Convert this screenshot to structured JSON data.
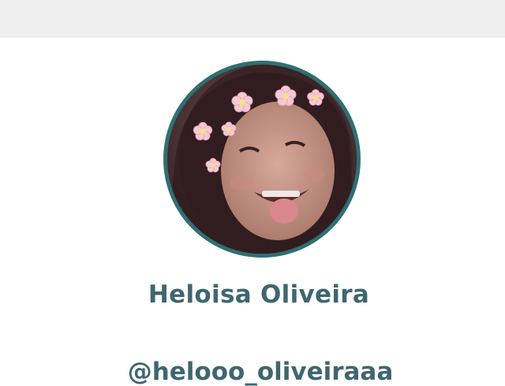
{
  "profile": {
    "display_name": "Heloisa Oliveira",
    "username": "@helooo_oliveiraaa",
    "avatar_description": "avatar-photo",
    "accent_color": "#2f6f72",
    "text_color": "#3f6670"
  },
  "header": {
    "background": "#efefef"
  }
}
